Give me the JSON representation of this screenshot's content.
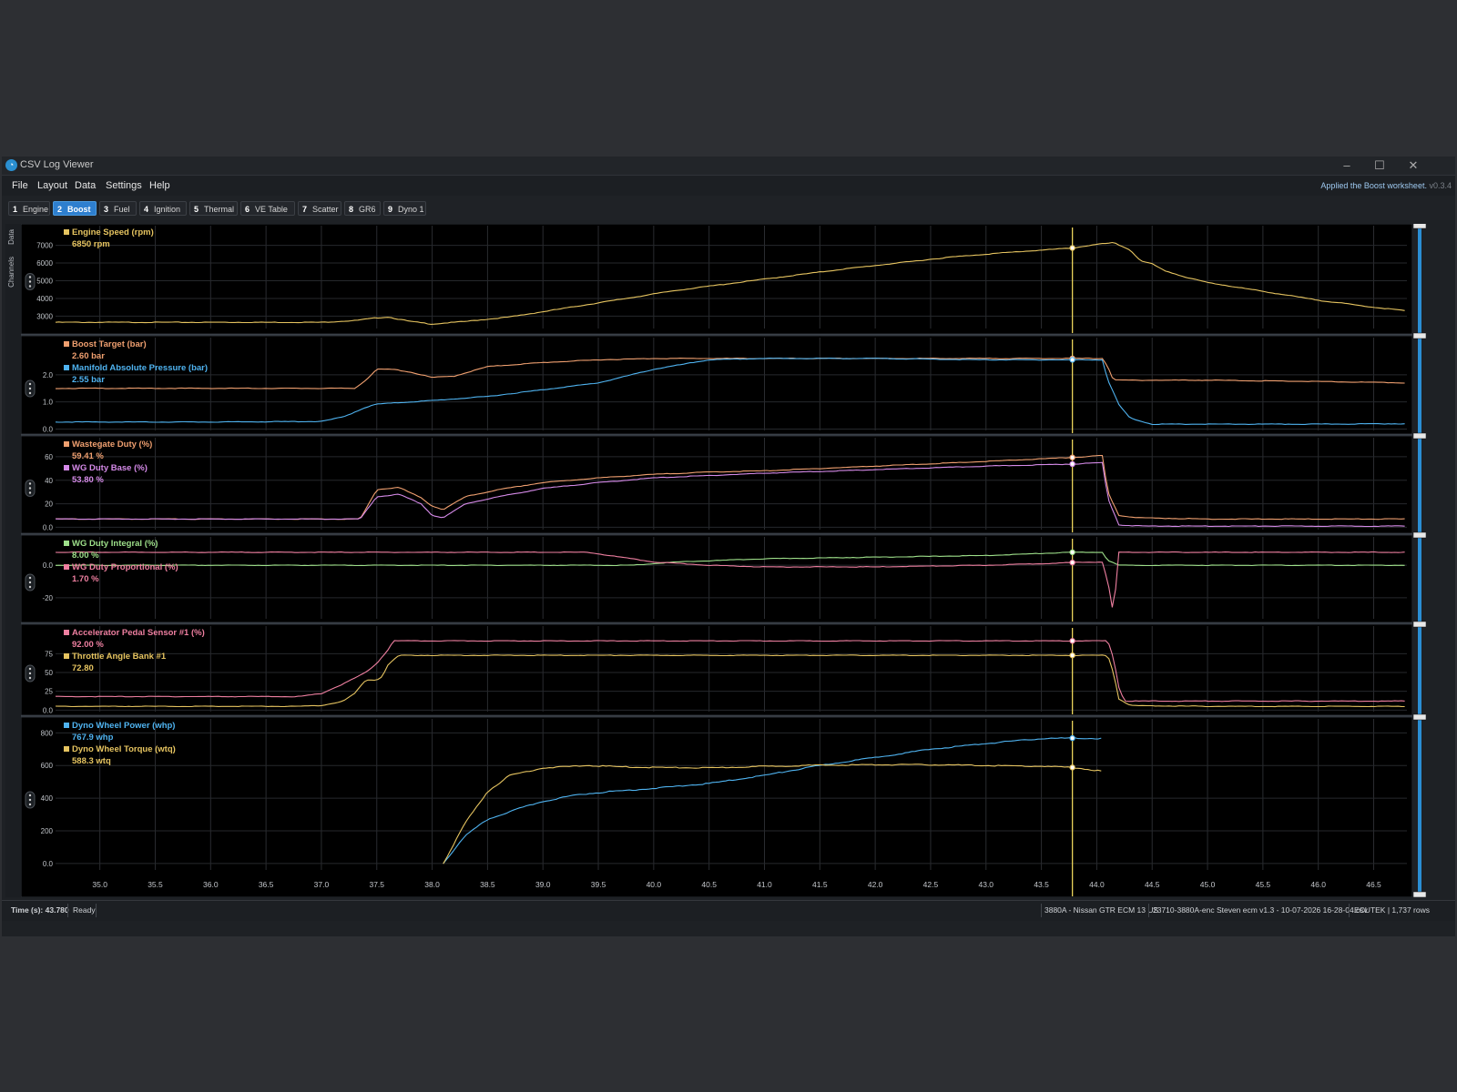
{
  "window": {
    "title": "CSV Log Viewer"
  },
  "menu": {
    "items": [
      "File",
      "Layout",
      "Data",
      "Settings",
      "Help"
    ]
  },
  "status_message": {
    "text": "Applied the Boost worksheet.",
    "version": "v0.3.4"
  },
  "tabs": [
    {
      "num": "1",
      "label": "Engine"
    },
    {
      "num": "2",
      "label": "Boost",
      "active": true
    },
    {
      "num": "3",
      "label": "Fuel"
    },
    {
      "num": "4",
      "label": "Ignition"
    },
    {
      "num": "5",
      "label": "Thermal"
    },
    {
      "num": "6",
      "label": "VE Table"
    },
    {
      "num": "7",
      "label": "Scatter"
    },
    {
      "num": "8",
      "label": "GR6"
    },
    {
      "num": "9",
      "label": "Dyno 1"
    }
  ],
  "side_tabs": [
    "Data",
    "Channels"
  ],
  "cursor_time": 43.78,
  "x_axis": {
    "range": [
      34.6,
      46.8
    ],
    "ticks": [
      "35.0",
      "35.5",
      "36.0",
      "36.5",
      "37.0",
      "37.5",
      "38.0",
      "38.5",
      "39.0",
      "39.5",
      "40.0",
      "40.5",
      "41.0",
      "41.5",
      "42.0",
      "42.5",
      "43.0",
      "43.5",
      "44.0",
      "44.5",
      "45.0",
      "45.5",
      "46.0",
      "46.5"
    ]
  },
  "colors": {
    "cursor": "#e8d25a",
    "yellow": "#e6c460",
    "orange": "#f0a070",
    "blue": "#4fb3f0",
    "violet": "#d58ae8",
    "green": "#9ee08a",
    "pink": "#ee7fa0"
  },
  "chart_data": [
    {
      "type": "line",
      "ylim": [
        2300,
        7700
      ],
      "yticks": [
        "3000",
        "4000",
        "5000",
        "6000",
        "7000"
      ],
      "series": [
        {
          "name": "Engine Speed (rpm)",
          "value_text": "6850 rpm",
          "color": "yellow",
          "x": [
            34.6,
            37.0,
            37.3,
            37.5,
            37.6,
            37.8,
            38.0,
            38.3,
            38.7,
            39.2,
            39.7,
            40.2,
            40.7,
            41.2,
            41.7,
            42.2,
            42.7,
            43.2,
            43.78,
            44.0,
            44.15,
            44.3,
            44.4,
            44.5,
            44.6,
            44.8,
            45.0,
            45.5,
            46.0,
            46.5,
            46.8
          ],
          "y": [
            2650,
            2650,
            2750,
            2900,
            2950,
            2700,
            2550,
            2700,
            2950,
            3450,
            3950,
            4450,
            4850,
            5250,
            5650,
            6000,
            6350,
            6600,
            6850,
            7050,
            7150,
            6750,
            6100,
            5950,
            5600,
            5200,
            4900,
            4400,
            3900,
            3500,
            3300
          ]
        }
      ]
    },
    {
      "type": "line",
      "ylim": [
        -0.05,
        3.1
      ],
      "yticks": [
        "0.0",
        "1.0",
        "2.0"
      ],
      "series": [
        {
          "name": "Boost Target (bar)",
          "value_text": "2.60 bar",
          "color": "orange",
          "x": [
            34.6,
            36.0,
            37.3,
            37.4,
            37.5,
            37.65,
            37.8,
            38.0,
            38.2,
            38.5,
            39.0,
            39.5,
            40.0,
            41.0,
            42.0,
            43.0,
            43.78,
            44.05,
            44.1,
            44.15,
            45.0,
            46.0,
            46.8
          ],
          "y": [
            1.5,
            1.5,
            1.5,
            1.8,
            2.2,
            2.2,
            2.1,
            1.9,
            1.95,
            2.3,
            2.45,
            2.55,
            2.6,
            2.6,
            2.6,
            2.6,
            2.6,
            2.6,
            2.3,
            1.8,
            1.8,
            1.75,
            1.7
          ]
        },
        {
          "name": "Manifold Absolute Pressure (bar)",
          "value_text": "2.55 bar",
          "color": "blue",
          "x": [
            34.6,
            36.0,
            37.0,
            37.2,
            37.4,
            37.5,
            38.0,
            38.5,
            39.0,
            39.5,
            40.0,
            40.5,
            41.0,
            42.0,
            43.0,
            43.78,
            44.05,
            44.1,
            44.2,
            44.3,
            44.5,
            45.0,
            46.0,
            46.8
          ],
          "y": [
            0.26,
            0.26,
            0.28,
            0.45,
            0.8,
            0.92,
            1.05,
            1.2,
            1.45,
            1.7,
            2.2,
            2.55,
            2.6,
            2.6,
            2.55,
            2.55,
            2.55,
            1.8,
            0.9,
            0.4,
            0.18,
            0.18,
            0.18,
            0.2
          ]
        }
      ]
    },
    {
      "type": "line",
      "ylim": [
        -2,
        70
      ],
      "yticks": [
        "0.0",
        "20",
        "40",
        "60"
      ],
      "series": [
        {
          "name": "Wastegate Duty (%)",
          "value_text": "59.41 %",
          "color": "orange",
          "x": [
            34.6,
            37.3,
            37.35,
            37.5,
            37.7,
            37.9,
            38.0,
            38.1,
            38.3,
            38.6,
            39.0,
            39.5,
            40.0,
            40.5,
            41.0,
            42.0,
            43.0,
            43.78,
            44.05,
            44.1,
            44.2,
            44.4,
            45.0,
            46.8
          ],
          "y": [
            7,
            7,
            7,
            32,
            34,
            25,
            18,
            15,
            26,
            32,
            38,
            42,
            45,
            47,
            48,
            52,
            56,
            59.4,
            61,
            30,
            10,
            8,
            7,
            7
          ]
        },
        {
          "name": "WG Duty Base (%)",
          "value_text": "53.80 %",
          "color": "violet",
          "x": [
            34.6,
            37.3,
            37.35,
            37.5,
            37.7,
            37.9,
            38.0,
            38.1,
            38.3,
            38.6,
            39.0,
            39.5,
            40.0,
            40.5,
            41.0,
            42.0,
            43.0,
            43.78,
            44.05,
            44.1,
            44.2,
            44.4,
            45.0,
            46.8
          ],
          "y": [
            7,
            7,
            7,
            26,
            28,
            20,
            10,
            8,
            20,
            26,
            33,
            38,
            42,
            44,
            46,
            49,
            52,
            53.8,
            55,
            25,
            2,
            1,
            1,
            1
          ]
        }
      ]
    },
    {
      "type": "line",
      "ylim": [
        -33,
        13
      ],
      "yticks": [
        "0.0",
        "-20"
      ],
      "series": [
        {
          "name": "WG Duty Integral (%)",
          "value_text": "8.00 %",
          "color": "green",
          "x": [
            34.6,
            39.8,
            40.2,
            41.0,
            42.0,
            43.0,
            43.78,
            44.05,
            44.1,
            44.2,
            46.8
          ],
          "y": [
            0,
            0,
            2,
            4,
            5,
            6,
            8,
            8,
            3,
            0,
            0
          ]
        },
        {
          "name": "WG Duty Proportional (%)",
          "value_text": "1.70 %",
          "color": "pink",
          "x": [
            34.6,
            35.7,
            39.4,
            39.7,
            40.0,
            40.5,
            41.0,
            42.0,
            43.0,
            43.5,
            43.78,
            44.05,
            44.1,
            44.15,
            44.2,
            44.4,
            45.0,
            46.8
          ],
          "y": [
            8,
            8,
            8,
            5,
            2,
            0,
            -1,
            -1,
            0,
            1,
            1.7,
            2,
            -10,
            -30,
            8,
            8,
            8,
            8
          ]
        }
      ]
    },
    {
      "type": "line",
      "ylim": [
        -2,
        102
      ],
      "yticks": [
        "0.0",
        "25",
        "50",
        "75"
      ],
      "series": [
        {
          "name": "Accelerator Pedal Sensor #1 (%)",
          "value_text": "92.00 %",
          "color": "pink",
          "x": [
            34.6,
            36.8,
            37.0,
            37.2,
            37.4,
            37.5,
            37.6,
            37.65,
            38.0,
            43.78,
            44.1,
            44.15,
            44.2,
            44.25,
            46.8
          ],
          "y": [
            18,
            18,
            22,
            35,
            50,
            62,
            80,
            92,
            92,
            92,
            92,
            70,
            30,
            12,
            12
          ]
        },
        {
          "name": "Throttle Angle Bank #1",
          "value_text": "72.80",
          "color": "yellow",
          "x": [
            34.6,
            36.8,
            37.0,
            37.2,
            37.3,
            37.4,
            37.5,
            37.55,
            37.6,
            37.7,
            38.0,
            43.78,
            44.1,
            44.15,
            44.2,
            44.3,
            45.0,
            46.8
          ],
          "y": [
            5,
            5,
            6,
            12,
            22,
            40,
            40,
            45,
            60,
            72.8,
            72.8,
            72.8,
            72.8,
            50,
            15,
            6,
            5,
            5
          ]
        }
      ]
    },
    {
      "type": "line",
      "ylim": [
        -40,
        830
      ],
      "yticks": [
        "0.0",
        "200",
        "400",
        "600",
        "800"
      ],
      "series": [
        {
          "name": "Dyno Wheel Power (whp)",
          "value_text": "767.9 whp",
          "color": "blue",
          "x": [
            38.1,
            38.3,
            38.5,
            38.8,
            39.0,
            39.3,
            39.6,
            40.0,
            40.5,
            41.0,
            41.5,
            42.0,
            42.5,
            43.0,
            43.5,
            43.78,
            44.05
          ],
          "y": [
            0,
            170,
            270,
            340,
            380,
            420,
            440,
            460,
            490,
            540,
            600,
            650,
            700,
            735,
            765,
            767.9,
            765
          ]
        },
        {
          "name": "Dyno Wheel Torque (wtq)",
          "value_text": "588.3 wtq",
          "color": "yellow",
          "x": [
            38.1,
            38.3,
            38.5,
            38.7,
            39.0,
            39.4,
            39.8,
            40.5,
            41.0,
            41.5,
            42.0,
            42.5,
            43.0,
            43.5,
            43.78,
            44.05
          ],
          "y": [
            0,
            250,
            440,
            540,
            585,
            600,
            590,
            585,
            595,
            602,
            605,
            605,
            600,
            595,
            588.3,
            565
          ]
        }
      ]
    }
  ],
  "statusbar": {
    "time_label": "Time (s): 43.780",
    "state": "Ready",
    "ecu": "3880A - Nissan GTR ECM 13 US",
    "file": "23710-3880A-enc Steven ecm v1.3 - 10-07-2026 16-28-04.csv",
    "source": "ECUTEK | 1,737 rows"
  }
}
